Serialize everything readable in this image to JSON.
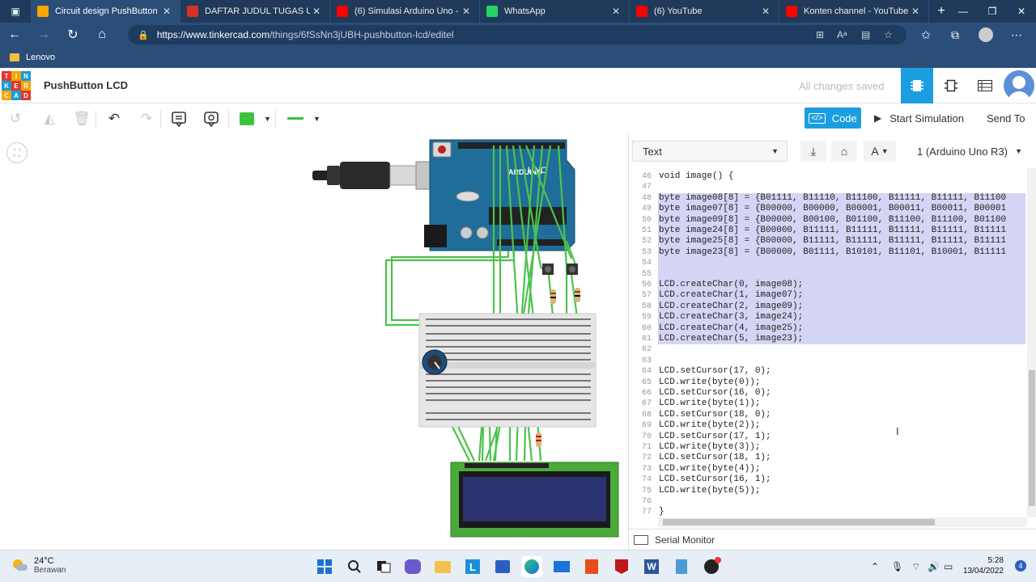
{
  "browser": {
    "tabs": [
      {
        "title": "Circuit design PushButton LCD",
        "favicon_color": "#f7a600",
        "active": true
      },
      {
        "title": "DAFTAR JUDUL TUGAS UTS",
        "favicon_color": "#d93025",
        "active": false
      },
      {
        "title": "(6) Simulasi Arduino Uno - ...",
        "favicon_color": "#ff0000",
        "active": false
      },
      {
        "title": "WhatsApp",
        "favicon_color": "#25d366",
        "active": false
      },
      {
        "title": "(6) YouTube",
        "favicon_color": "#ff0000",
        "active": false
      },
      {
        "title": "Konten channel - YouTube S...",
        "favicon_color": "#ff0000",
        "active": false
      }
    ],
    "url_host": "https://www.tinkercad.com",
    "url_path": "/things/6fSsNn3jUBH-pushbutton-lcd/editel",
    "bookmark": "Lenovo"
  },
  "tinkercad": {
    "logo_letters": [
      "T",
      "I",
      "N",
      "K",
      "E",
      "R",
      "C",
      "A",
      "D"
    ],
    "logo_colors": [
      "#e1382d",
      "#f7a600",
      "#1b9bd7",
      "#1b9bd7",
      "#e1382d",
      "#f7a600",
      "#f7a600",
      "#1b9bd7",
      "#e1382d"
    ],
    "project_title": "PushButton LCD",
    "save_status": "All changes saved",
    "code_button": "Code",
    "code_icon": "</>",
    "start_simulation": "Start Simulation",
    "send_to": "Send To",
    "accent": "#1a9ee0"
  },
  "code_panel": {
    "mode_select": "Text",
    "board_select": "1 (Arduino Uno R3)",
    "serial_monitor": "Serial Monitor",
    "lines": [
      {
        "n": "46",
        "t": "void image() {",
        "hl": false
      },
      {
        "n": "47",
        "t": "",
        "hl": false
      },
      {
        "n": "48",
        "t": "byte image08[8] = {B01111, B11110, B11100, B11111, B11111, B11100",
        "hl": true
      },
      {
        "n": "49",
        "t": "byte image07[8] = {B00000, B00000, B00001, B00011, B00011, B00001",
        "hl": true
      },
      {
        "n": "50",
        "t": "byte image09[8] = {B00000, B00100, B01100, B11100, B11100, B01100",
        "hl": true
      },
      {
        "n": "51",
        "t": "byte image24[8] = {B00000, B11111, B11111, B11111, B11111, B11111",
        "hl": true
      },
      {
        "n": "52",
        "t": "byte image25[8] = {B00000, B11111, B11111, B11111, B11111, B11111",
        "hl": true
      },
      {
        "n": "53",
        "t": "byte image23[8] = {B00000, B01111, B10101, B11101, B10001, B11111",
        "hl": true
      },
      {
        "n": "54",
        "t": "",
        "hl": true
      },
      {
        "n": "55",
        "t": "",
        "hl": true
      },
      {
        "n": "56",
        "t": "LCD.createChar(0, image08);",
        "hl": true
      },
      {
        "n": "57",
        "t": "LCD.createChar(1, image07);",
        "hl": true
      },
      {
        "n": "58",
        "t": "LCD.createChar(2, image09);",
        "hl": true
      },
      {
        "n": "59",
        "t": "LCD.createChar(3, image24);",
        "hl": true
      },
      {
        "n": "60",
        "t": "LCD.createChar(4, image25);",
        "hl": true
      },
      {
        "n": "61",
        "t": "LCD.createChar(5, image23);",
        "hl": true
      },
      {
        "n": "62",
        "t": "",
        "hl": false
      },
      {
        "n": "63",
        "t": "",
        "hl": false
      },
      {
        "n": "64",
        "t": "LCD.setCursor(17, 0);",
        "hl": false
      },
      {
        "n": "65",
        "t": "LCD.write(byte(0));",
        "hl": false
      },
      {
        "n": "66",
        "t": "LCD.setCursor(16, 0);",
        "hl": false
      },
      {
        "n": "67",
        "t": "LCD.write(byte(1));",
        "hl": false
      },
      {
        "n": "68",
        "t": "LCD.setCursor(18, 0);",
        "hl": false
      },
      {
        "n": "69",
        "t": "LCD.write(byte(2));",
        "hl": false
      },
      {
        "n": "70",
        "t": "LCD.setCursor(17, 1);",
        "hl": false
      },
      {
        "n": "71",
        "t": "LCD.write(byte(3));",
        "hl": false
      },
      {
        "n": "72",
        "t": "LCD.setCursor(18, 1);",
        "hl": false
      },
      {
        "n": "73",
        "t": "LCD.write(byte(4));",
        "hl": false
      },
      {
        "n": "74",
        "t": "LCD.setCursor(16, 1);",
        "hl": false
      },
      {
        "n": "75",
        "t": "LCD.write(byte(5));",
        "hl": false
      },
      {
        "n": "76",
        "t": "",
        "hl": false
      },
      {
        "n": "77",
        "t": "}",
        "hl": false
      }
    ]
  },
  "circuit": {
    "board_label": "UNO",
    "brand_label": "ARDUINO"
  },
  "taskbar": {
    "temperature": "24°C",
    "weather_desc": "Berawan",
    "time": "5:28",
    "date": "13/04/2022",
    "notification_count": "4"
  }
}
